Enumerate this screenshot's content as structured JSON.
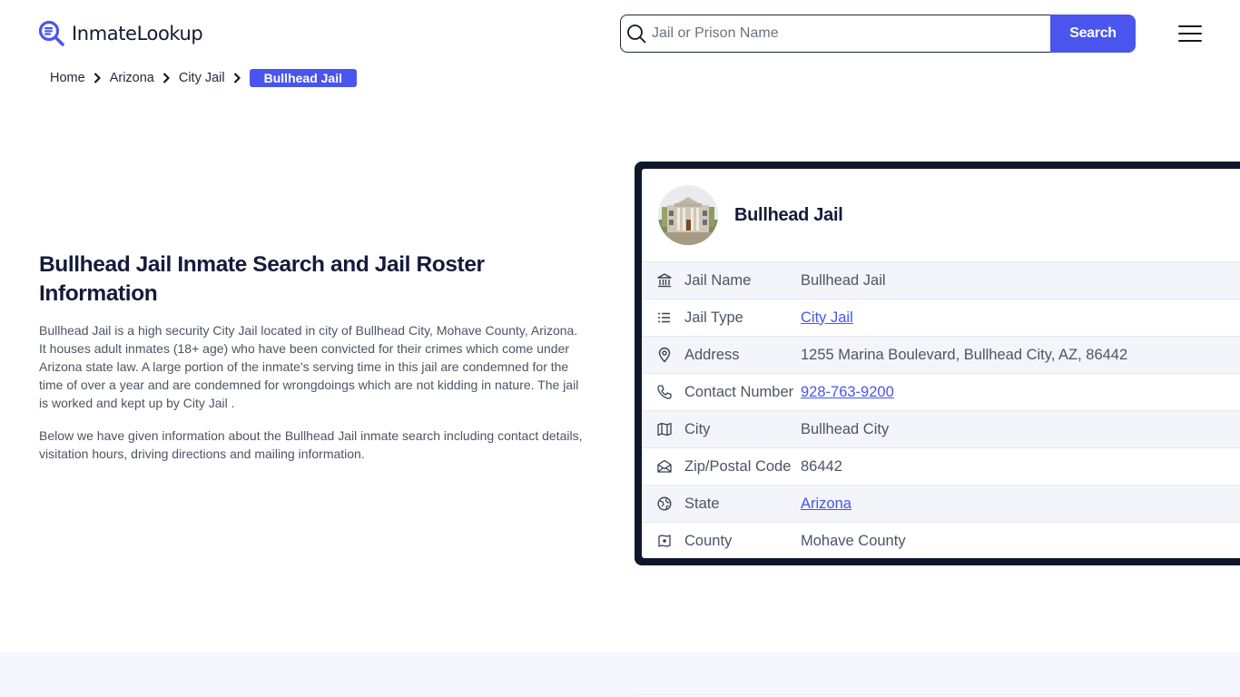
{
  "header": {
    "logo_text": "InmateLookup",
    "search_placeholder": "Jail or Prison Name",
    "search_value": "",
    "search_button": "Search",
    "menu_icon": "hamburger-icon",
    "brand_color": "#4a55ee"
  },
  "breadcrumb": {
    "items": [
      "Home",
      "Arizona",
      "City Jail"
    ],
    "active": "Bullhead Jail"
  },
  "main": {
    "title": "Bullhead Jail Inmate Search and Jail Roster Information",
    "paragraphs": [
      "Bullhead Jail is a high security City Jail located in city of Bullhead City, Mohave County, Arizona. It houses adult inmates (18+ age) who have been convicted for their crimes which come under Arizona state law. A large portion of the inmate's serving time in this jail are condemned for the time of over a year and are condemned for wrongdoings which are not kidding in nature. The jail is worked and kept up by City Jail .",
      "Below we have given information about the Bullhead Jail inmate search including contact details, visitation hours, driving directions and mailing information."
    ]
  },
  "card": {
    "title": "Bullhead Jail",
    "rows": [
      {
        "icon": "building-icon",
        "label": "Jail Name",
        "value": "Bullhead Jail",
        "link": false
      },
      {
        "icon": "list-icon",
        "label": "Jail Type",
        "value": "City Jail",
        "link": true
      },
      {
        "icon": "location-pin-icon",
        "label": "Address",
        "value": "1255 Marina Boulevard, Bullhead City, AZ, 86442",
        "link": false
      },
      {
        "icon": "phone-icon",
        "label": "Contact Number",
        "value": "928-763-9200",
        "link": true
      },
      {
        "icon": "map-icon",
        "label": "City",
        "value": "Bullhead City",
        "link": false
      },
      {
        "icon": "mail-icon",
        "label": "Zip/Postal Code",
        "value": "86442",
        "link": false
      },
      {
        "icon": "globe-icon",
        "label": "State",
        "value": "Arizona",
        "link": true
      },
      {
        "icon": "county-map-icon",
        "label": "County",
        "value": "Mohave County",
        "link": false
      }
    ]
  }
}
